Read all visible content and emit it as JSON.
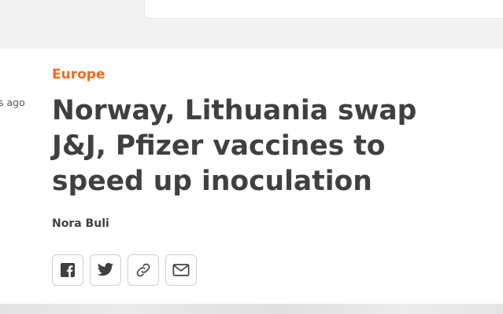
{
  "article": {
    "timestamp": "s ago",
    "category": "Europe",
    "headline": "Norway, Lithuania swap J&J, Pfizer vaccines to speed up inoculation",
    "author": "Nora Buli"
  },
  "share_icons": [
    "facebook-icon",
    "twitter-icon",
    "link-icon",
    "email-icon"
  ],
  "colors": {
    "category": "#ef6c1a",
    "text": "#404040",
    "muted": "#555555"
  }
}
